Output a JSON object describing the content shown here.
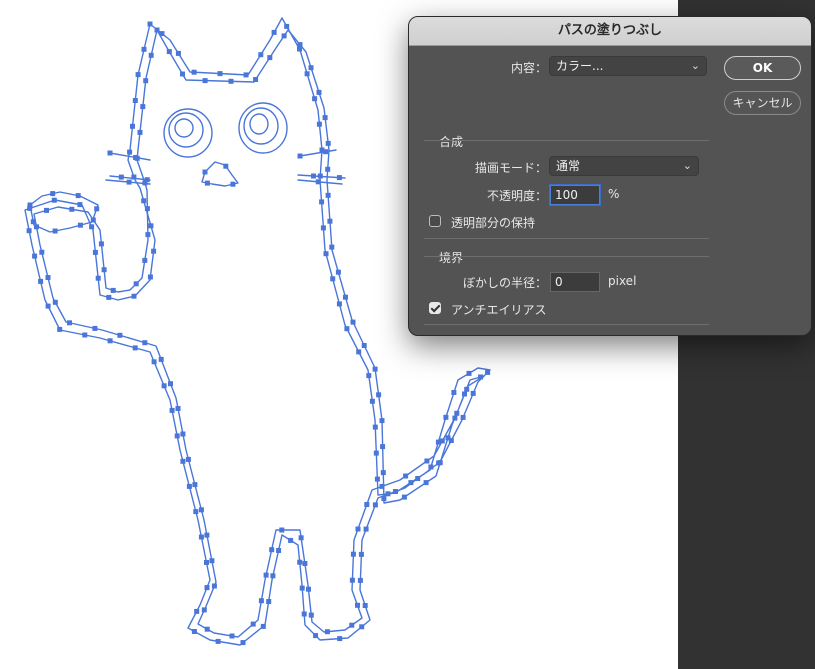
{
  "dialog": {
    "title": "パスの塗りつぶし",
    "contents_label": "内容：",
    "contents_value": "カラー...",
    "ok_label": "OK",
    "cancel_label": "キャンセル",
    "blending": {
      "section_title": "合成",
      "mode_label": "描画モード：",
      "mode_value": "通常",
      "opacity_label": "不透明度：",
      "opacity_value": "100",
      "opacity_unit": "%",
      "preserve_label": "透明部分の保持",
      "preserve_checked": false
    },
    "rendering": {
      "section_title": "境界",
      "feather_label": "ぼかしの半径：",
      "feather_value": "0",
      "feather_unit": "pixel",
      "antialias_label": "アンチエイリアス",
      "antialias_checked": true
    }
  },
  "colors": {
    "path": "#4a76d9",
    "dialog_bg": "#535353",
    "right_panel": "#323232"
  },
  "icons": {
    "dropdown": "chevron-down-icon",
    "checkbox": "checkbox-icon"
  }
}
